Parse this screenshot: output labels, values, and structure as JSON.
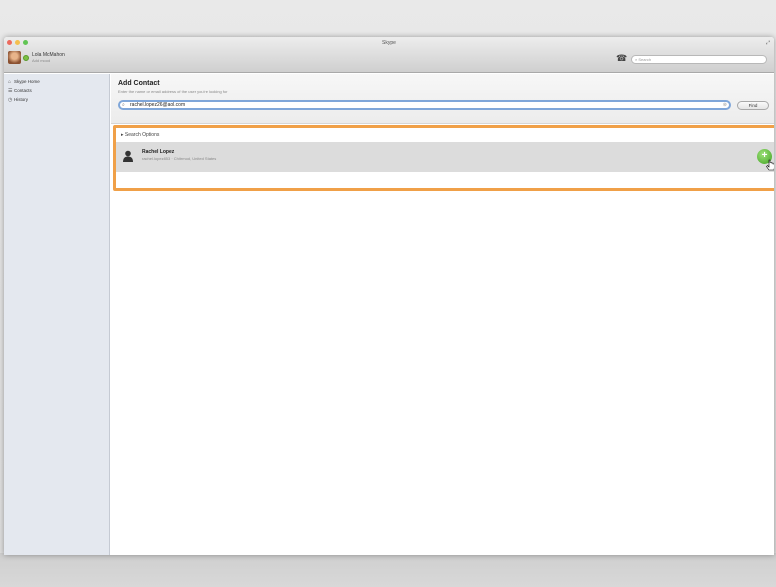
{
  "window": {
    "title": "Skype"
  },
  "profile": {
    "name": "Lola McMahon",
    "mood": "Add mood"
  },
  "toolbar": {
    "search_placeholder": "Search"
  },
  "sidebar": {
    "items": [
      {
        "icon": "home-icon",
        "label": "Skype Home"
      },
      {
        "icon": "contacts-icon",
        "label": "Contacts"
      },
      {
        "icon": "history-icon",
        "label": "History"
      }
    ]
  },
  "add_contact": {
    "title": "Add Contact",
    "subtitle": "Enter the name or email address of the user you're looking for",
    "input_value": "rachel.lopez26@aol.com",
    "find_label": "Find",
    "search_options_label": "Search Options"
  },
  "results": [
    {
      "name": "Rachel Lopez",
      "detail": "rachel.lopez853 · Chitrmod, United States"
    }
  ],
  "colors": {
    "highlight": "#f0a048",
    "input_focus": "#7fa6d9",
    "add_button": "#3ea320"
  }
}
